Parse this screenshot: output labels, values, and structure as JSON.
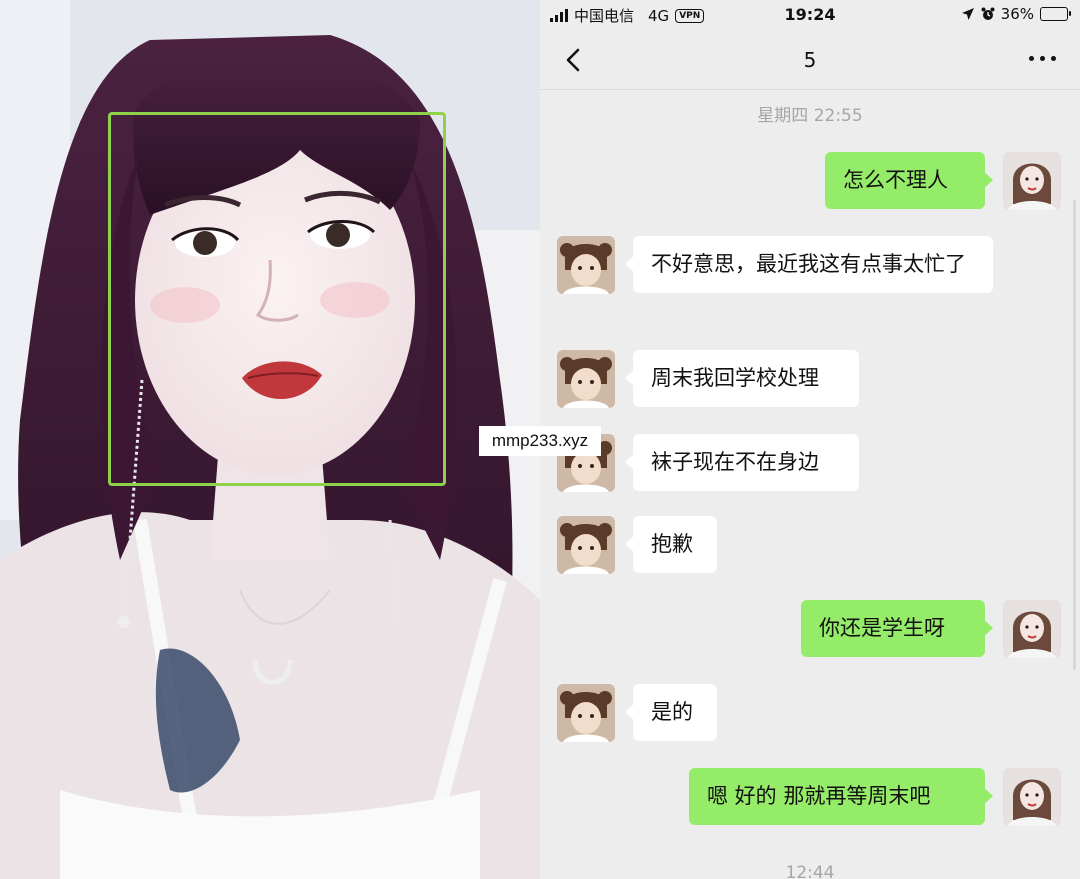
{
  "watermark": "mmp233.xyz",
  "status_bar": {
    "carrier": "中国电信",
    "network": "4G",
    "vpn": "VPN",
    "time": "19:24",
    "battery": "36%",
    "battery_level": 0.36
  },
  "nav": {
    "title": "5"
  },
  "timestamps": [
    "星期四 22:55",
    "12:44"
  ],
  "messages": [
    {
      "side": "out",
      "text": "怎么不理人"
    },
    {
      "side": "in",
      "text": "不好意思，最近我这有点事太忙了"
    },
    {
      "side": "in",
      "text": "周末我回学校处理"
    },
    {
      "side": "in",
      "text": "袜子现在不在身边"
    },
    {
      "side": "in",
      "text": "抱歉"
    },
    {
      "side": "out",
      "text": "你还是学生呀"
    },
    {
      "side": "in",
      "text": "是的"
    },
    {
      "side": "out",
      "text": "嗯 好的 那就再等周末吧"
    }
  ],
  "colors": {
    "face_box": "#8ed24a",
    "bubble_out": "#95ec69",
    "bubble_in": "#ffffff",
    "chat_bg": "#ededed"
  }
}
